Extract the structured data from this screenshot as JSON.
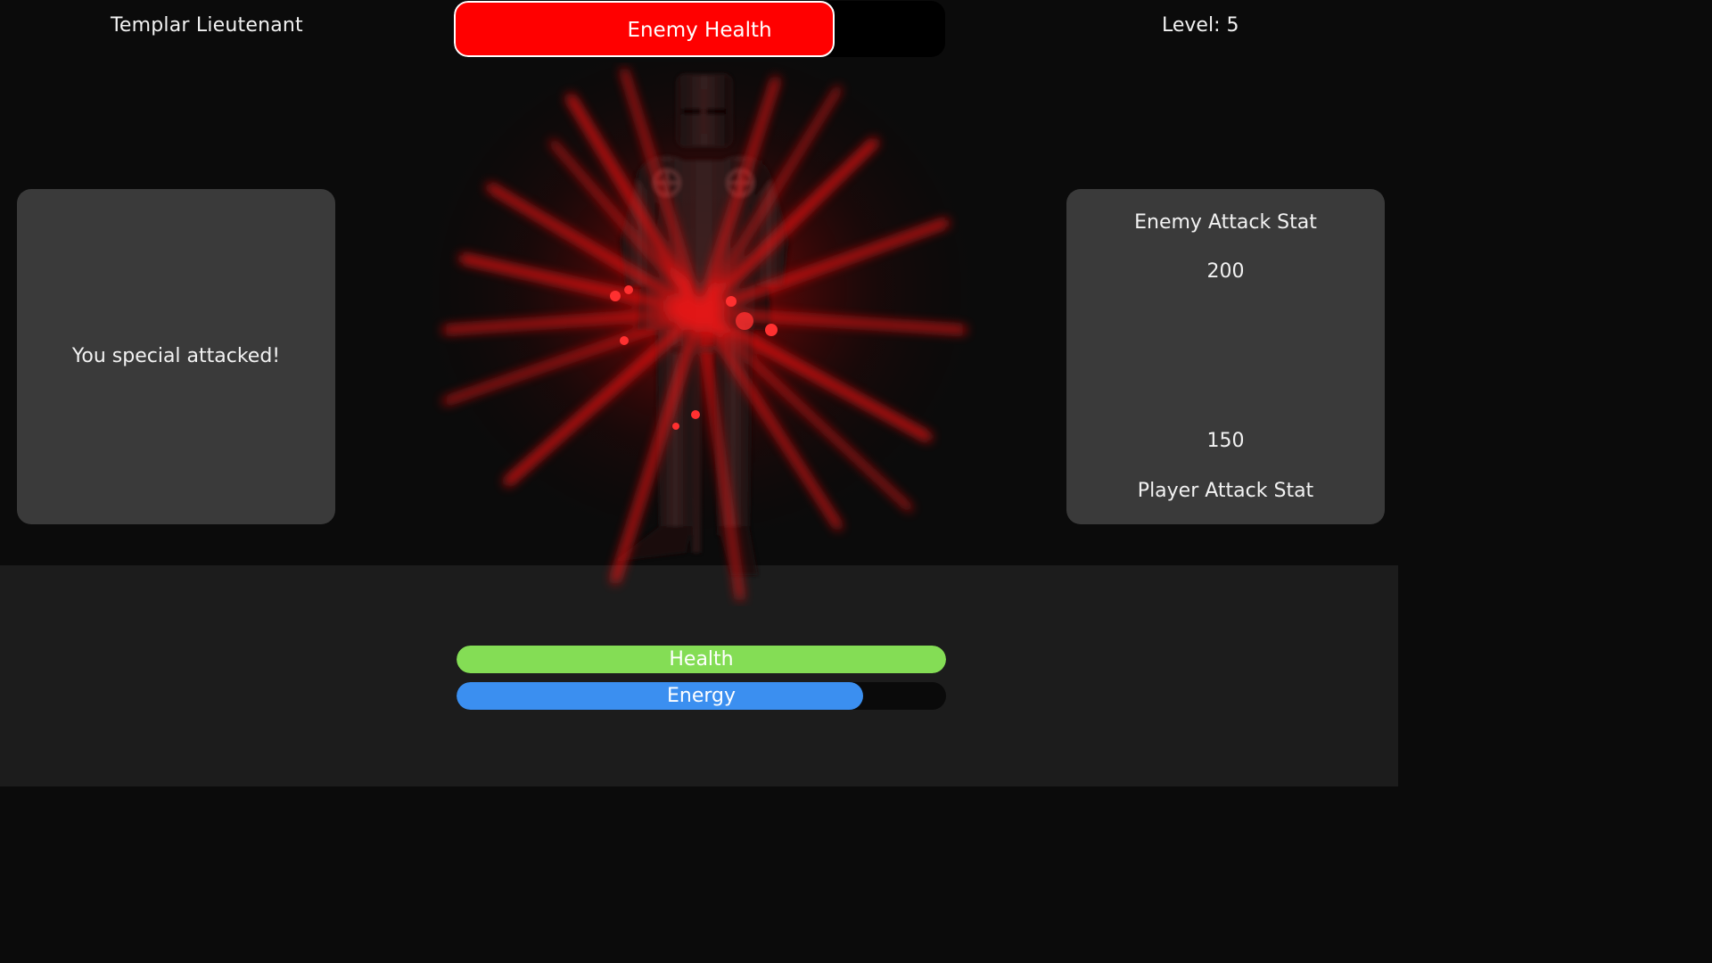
{
  "enemy": {
    "name": "Templar Lieutenant",
    "health_label": "Enemy Health",
    "health_fraction": 0.775,
    "health_color": "#ff0000"
  },
  "level": {
    "label": "Level: 5"
  },
  "log": {
    "message": "You special attacked!"
  },
  "stats": {
    "enemy_attack_label": "Enemy Attack Stat",
    "enemy_attack_value": "200",
    "player_attack_value": "150",
    "player_attack_label": "Player Attack Stat"
  },
  "player": {
    "health_label": "Health",
    "health_fraction": 1.0,
    "health_color": "#84dd55",
    "energy_label": "Energy",
    "energy_fraction": 0.83,
    "energy_color": "#3b8ff0"
  },
  "sprite": {
    "icon": "templar-knight-sprite",
    "effect": "red-special-attack-burst",
    "effect_color": "#ff1010"
  }
}
